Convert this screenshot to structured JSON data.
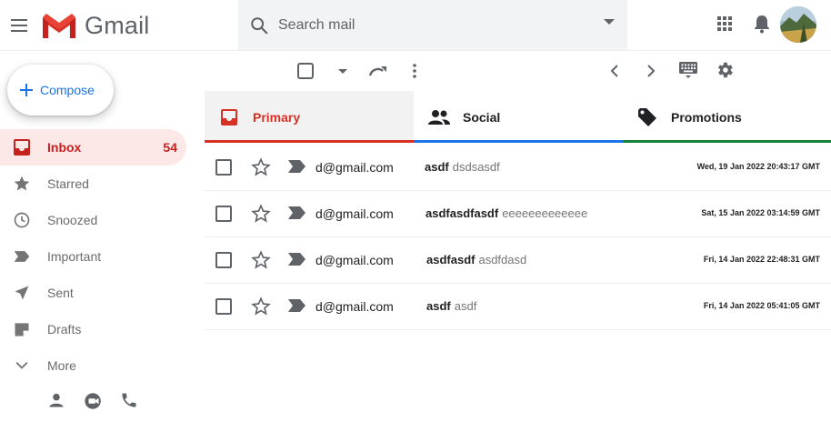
{
  "app": {
    "name": "Gmail"
  },
  "colors": {
    "gmail_red": "#d93025",
    "primary_tab": "#d93025",
    "social_tab": "#1a73e8",
    "promotions_tab": "#188038",
    "inbox_bg": "#fce8e6"
  },
  "header": {
    "menu_icon": "hamburger-menu-icon",
    "logo_text": "Gmail",
    "search": {
      "placeholder": "Search mail",
      "value": ""
    },
    "apps_icon": "apps-grid-icon",
    "notifications_icon": "bell-icon",
    "avatar": "user-avatar"
  },
  "sidebar": {
    "compose_label": "Compose",
    "items": [
      {
        "label": "Inbox",
        "count": "54",
        "icon": "inbox-icon",
        "active": true
      },
      {
        "label": "Starred",
        "count": "",
        "icon": "star-icon"
      },
      {
        "label": "Snoozed",
        "count": "",
        "icon": "clock-icon"
      },
      {
        "label": "Important",
        "count": "",
        "icon": "important-icon"
      },
      {
        "label": "Sent",
        "count": "",
        "icon": "send-icon"
      },
      {
        "label": "Drafts",
        "count": "",
        "icon": "draft-icon"
      },
      {
        "label": "More",
        "count": "",
        "icon": "chevron-down-icon"
      }
    ],
    "bottom_icons": [
      "person-icon",
      "video-icon",
      "phone-icon"
    ]
  },
  "toolbar": {
    "icons": [
      "select-checkbox",
      "caret-down-icon",
      "refresh-icon",
      "more-vert-icon",
      "chevron-left-icon",
      "chevron-right-icon",
      "keyboard-icon",
      "settings-icon"
    ]
  },
  "tabs": [
    {
      "label": "Primary",
      "icon": "inbox-tab-icon",
      "active": true
    },
    {
      "label": "Social",
      "icon": "people-icon"
    },
    {
      "label": "Promotions",
      "icon": "tag-icon"
    }
  ],
  "emails": [
    {
      "from": "d@gmail.com",
      "subject": "asdf",
      "snippet": "dsdsasdf",
      "date": "Wed, 19 Jan 2022 20:43:17 GMT"
    },
    {
      "from": "d@gmail.com",
      "subject": "asdfasdfasdf",
      "snippet": "eeeeeeeeeeeee",
      "date": "Sat, 15 Jan 2022 03:14:59 GMT"
    },
    {
      "from": "d@gmail.com",
      "subject": "asdfasdf",
      "snippet": "asdfdasd",
      "date": "Fri, 14 Jan 2022 22:48:31 GMT"
    },
    {
      "from": "d@gmail.com",
      "subject": "asdf",
      "snippet": "asdf",
      "date": "Fri, 14 Jan 2022 05:41:05 GMT"
    }
  ]
}
